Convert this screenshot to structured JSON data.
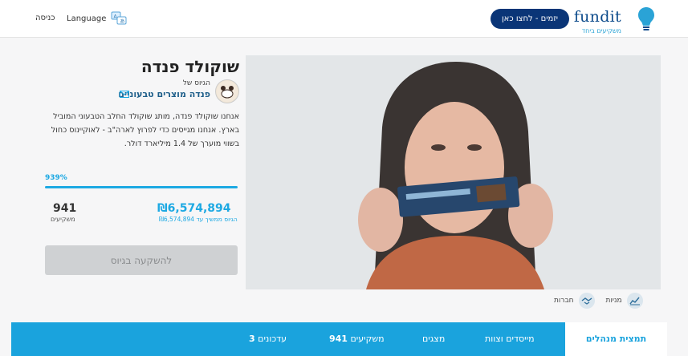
{
  "header": {
    "logo_text": "fundit",
    "logo_tagline": "משקיעים ביחד",
    "cta_label": "יזמים - לחצו כאן",
    "language_label": "Language",
    "login_label": "כניסה"
  },
  "campaign": {
    "title": "שוקולד פנדה",
    "presented_by": "הגיוס של",
    "company_name": "פנדה מוצרים טבעוניים",
    "description": "אנחנו שוקולד פנדה, מותג שוקולד החלב הטבעוני המוביל בארץ. אנחנו מגייסים כדי לפרוץ לארה\"ב - לאוקיינוס כחול בשווי מוערך של 1.4 מיליארד דולר.",
    "progress_percent_label": "939%",
    "progress_percent": 100,
    "amount_raised": "₪6,574,894",
    "amount_sub": "הגיוס ממשיך עד ₪6,574,894",
    "investors_count": "941",
    "investors_label": "משקיעים",
    "invest_button": "להשקעה בגיוס"
  },
  "tags": [
    {
      "label": "מניות",
      "icon": "chart-line-icon"
    },
    {
      "label": "חברות",
      "icon": "handshake-icon"
    }
  ],
  "tabs": {
    "management": "תמצית מנהלים",
    "founders": "מייסדים וצוות",
    "pitch": "מצגים",
    "investors_text": "משקיעים",
    "investors_count": "941",
    "updates_text": "עדכונים",
    "updates_count": "3"
  },
  "colors": {
    "brand_navy": "#0a3577",
    "accent_blue": "#1aa3dd",
    "disabled_button": "#cfd1d3"
  }
}
